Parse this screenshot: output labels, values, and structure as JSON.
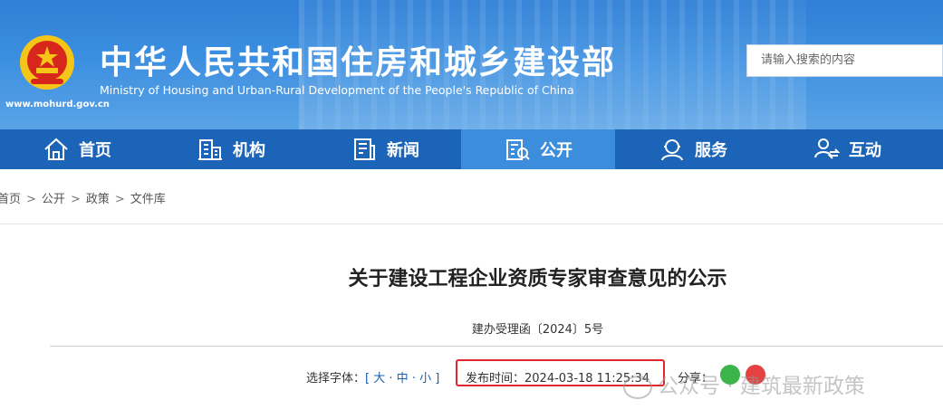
{
  "header": {
    "title": "中华人民共和国住房和城乡建设部",
    "subtitle": "Ministry of Housing and Urban-Rural Development of the People's Republic of China",
    "url": "www.mohurd.gov.cn",
    "search_placeholder": "请输入搜索的内容"
  },
  "nav": {
    "items": [
      {
        "label": "首页",
        "icon": "home-icon"
      },
      {
        "label": "机构",
        "icon": "building-icon"
      },
      {
        "label": "新闻",
        "icon": "news-icon"
      },
      {
        "label": "公开",
        "icon": "disclosure-icon",
        "active": true
      },
      {
        "label": "服务",
        "icon": "service-icon"
      },
      {
        "label": "互动",
        "icon": "interaction-icon"
      }
    ]
  },
  "breadcrumb": [
    "首页",
    "公开",
    "政策",
    "文件库"
  ],
  "breadcrumb_separator": ">",
  "article": {
    "title": "关于建设工程企业资质专家审查意见的公示",
    "doc_number": "建办受理函〔2024〕5号",
    "font_size_label": "选择字体：",
    "font_size_open": "[",
    "font_size_large": "大",
    "font_size_medium": "中",
    "font_size_small": "小",
    "font_size_dash": "·",
    "font_size_close": "]",
    "publish_time": "发布时间：2024-03-18 11:25:34",
    "share_label": "分享："
  },
  "watermark": "公众号 · 建筑最新政策",
  "colors": {
    "header_blue": "#3c8fe0",
    "nav_blue": "#1c64b7",
    "nav_active": "#3d8ddd",
    "highlight_red": "#e3262b",
    "link_blue": "#1a5fb4"
  }
}
